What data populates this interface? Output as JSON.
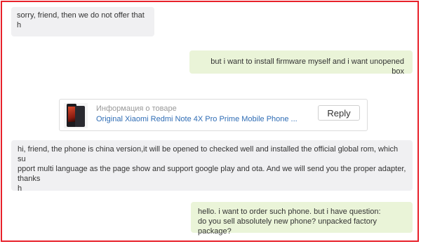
{
  "conversation": {
    "messages": [
      {
        "direction": "incoming",
        "text": "sorry, friend, then we do not offer that\nh"
      },
      {
        "direction": "outgoing",
        "text": "but i want to install firmware myself and i want unopened box"
      },
      {
        "direction": "incoming",
        "text": "hi, friend, the phone is china version,it will be opened to checked well and installed the official global rom, which su\npport multi language as the page show and support google play and ota. And we will send you the proper adapter, thanks\nh"
      },
      {
        "direction": "outgoing",
        "text": "hello. i want to order such phone. but i have question:\ndo you sell absolutely new phone? unpacked factory package?"
      }
    ],
    "product_card": {
      "label": "Информация о товаре",
      "title": "Original Xiaomi Redmi Note 4X Pro Prime Mobile Phone ...",
      "reply_label": "Reply",
      "thumbnail_icon": "phone-thumbnail"
    }
  },
  "colors": {
    "frame_border": "#e8202a",
    "incoming_bubble": "#f0f0f2",
    "outgoing_bubble": "#eaf4d8",
    "link": "#2f6db5"
  }
}
